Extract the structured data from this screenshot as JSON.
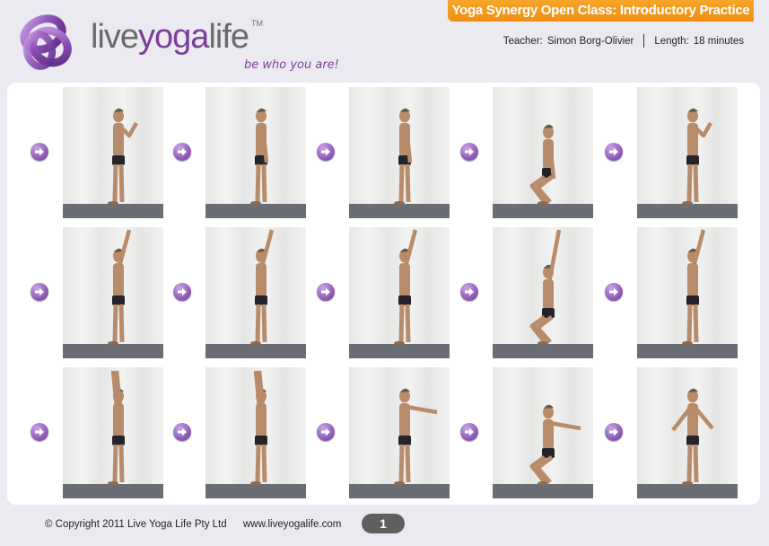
{
  "brand": {
    "name_live": "live",
    "name_yoga": "yoga",
    "name_life": "life",
    "trademark": "TM",
    "tagline": "be who you are!",
    "logo_icon": "interlocking-rings-icon"
  },
  "header": {
    "title": "Yoga Synergy Open Class: Introductory Practice",
    "teacher_label": "Teacher:",
    "teacher_name": "Simon Borg-Olivier",
    "length_label": "Length:",
    "length_value": "18 minutes"
  },
  "colors": {
    "brand_purple": "#7a3f98",
    "banner_orange": "#f39c1f",
    "floor_gray": "#6b6d74"
  },
  "sequence": {
    "arrow_icon": "right-arrow-icon",
    "rows": [
      {
        "steps": [
          {
            "pose": "standing-palms-together"
          },
          {
            "pose": "standing-arms-down"
          },
          {
            "pose": "standing-arms-down-relaxed"
          },
          {
            "pose": "standing-slight-squat"
          },
          {
            "pose": "standing-palms-together"
          }
        ]
      },
      {
        "steps": [
          {
            "pose": "arm-raised"
          },
          {
            "pose": "arm-raised"
          },
          {
            "pose": "arm-raised"
          },
          {
            "pose": "squat-arm-raised"
          },
          {
            "pose": "backbend-arm-raised"
          }
        ]
      },
      {
        "steps": [
          {
            "pose": "arms-overhead"
          },
          {
            "pose": "arms-overhead"
          },
          {
            "pose": "arms-forward"
          },
          {
            "pose": "squat-arms-forward"
          },
          {
            "pose": "arms-swing-back"
          }
        ]
      }
    ]
  },
  "footer": {
    "copyright": "© Copyright 2011 Live Yoga Life Pty Ltd",
    "website": "www.liveyogalife.com",
    "page": "1"
  }
}
